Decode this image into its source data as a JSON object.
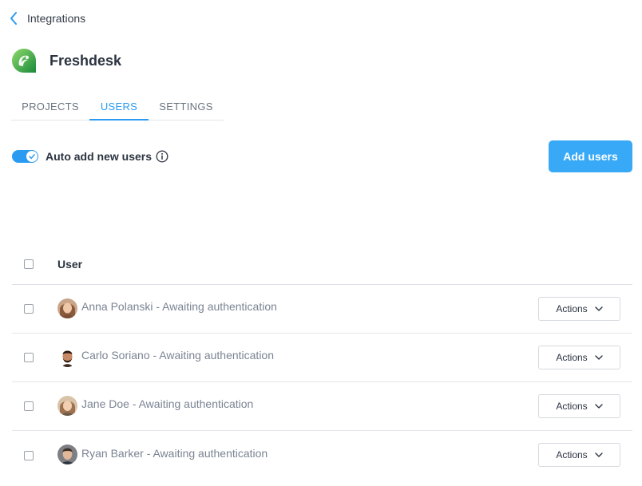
{
  "breadcrumb": {
    "label": "Integrations",
    "icon": "chevron-left-icon",
    "color": "#2a9bf0"
  },
  "app": {
    "name": "Freshdesk",
    "logo_icon": "freshdesk-logo",
    "logo_colors": [
      "#7ccf5f",
      "#1f8f3e"
    ]
  },
  "tabs": [
    {
      "label": "PROJECTS",
      "active": false
    },
    {
      "label": "USERS",
      "active": true
    },
    {
      "label": "SETTINGS",
      "active": false
    }
  ],
  "auto_add": {
    "label": "Auto add new users",
    "enabled": true,
    "info_icon": "info-icon"
  },
  "add_users_button": {
    "label": "Add users",
    "color": "#38a9f7"
  },
  "table": {
    "column_user": "User",
    "rows": [
      {
        "name": "Anna Polanski - Awaiting authentication",
        "avatar": "avatar-anna",
        "actions_label": "Actions"
      },
      {
        "name": "Carlo Soriano - Awaiting authentication",
        "avatar": "avatar-carlo",
        "actions_label": "Actions"
      },
      {
        "name": "Jane Doe - Awaiting authentication",
        "avatar": "avatar-jane",
        "actions_label": "Actions"
      },
      {
        "name": "Ryan Barker - Awaiting authentication",
        "avatar": "avatar-ryan",
        "actions_label": "Actions"
      }
    ]
  }
}
